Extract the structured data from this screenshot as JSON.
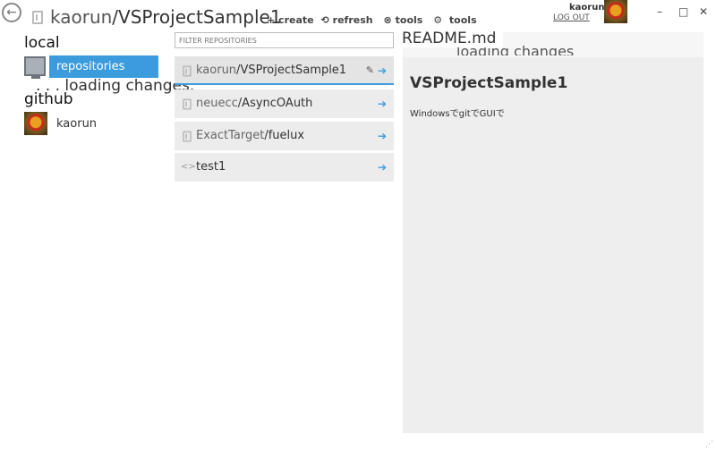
{
  "header": {
    "owner": "kaorun",
    "separator": "/",
    "repo": "VSProjectSample1",
    "toolbar": {
      "create": "+ create",
      "refresh": "refresh",
      "tools_dup": "tools",
      "tools": "tools"
    }
  },
  "user": {
    "name": "kaorun",
    "logout": "LOG OUT"
  },
  "window": {
    "minimize": "–",
    "maximize": "□",
    "close": "✕"
  },
  "local": {
    "heading": "local",
    "repositories_label": "repositories",
    "loading": ". . . loading changes."
  },
  "github": {
    "heading": "github",
    "user": "kaorun"
  },
  "filter": {
    "placeholder": "FILTER REPOSITORIES"
  },
  "repos": [
    {
      "owner": "kaorun",
      "sep": "/",
      "name": "VSProjectSample1"
    },
    {
      "owner": "neuecc",
      "sep": "/",
      "name": "AsyncOAuth"
    },
    {
      "owner": "ExactTarget",
      "sep": "/",
      "name": "fuelux"
    },
    {
      "owner": "",
      "sep": "",
      "name": "test1"
    }
  ],
  "readme": {
    "label": "README.md",
    "loading": "loading changes",
    "heading": "VSProjectSample1",
    "text": "WindowsでgitでGUIで"
  },
  "accent": "#3b9bdc"
}
